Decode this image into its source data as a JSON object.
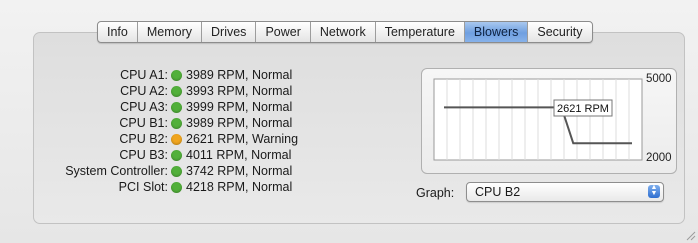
{
  "tabs": [
    {
      "label": "Info"
    },
    {
      "label": "Memory"
    },
    {
      "label": "Drives"
    },
    {
      "label": "Power"
    },
    {
      "label": "Network"
    },
    {
      "label": "Temperature"
    },
    {
      "label": "Blowers",
      "selected": true
    },
    {
      "label": "Security"
    }
  ],
  "blowers": [
    {
      "label": "CPU A1:",
      "value": "3989 RPM, Normal",
      "status": "normal"
    },
    {
      "label": "CPU A2:",
      "value": "3993 RPM, Normal",
      "status": "normal"
    },
    {
      "label": "CPU A3:",
      "value": "3999 RPM, Normal",
      "status": "normal"
    },
    {
      "label": "CPU B1:",
      "value": "3989 RPM, Normal",
      "status": "normal"
    },
    {
      "label": "CPU B2:",
      "value": "2621 RPM, Warning",
      "status": "warning"
    },
    {
      "label": "CPU B3:",
      "value": "4011 RPM, Normal",
      "status": "normal"
    },
    {
      "label": "System Controller:",
      "value": "3742 RPM, Normal",
      "status": "normal"
    },
    {
      "label": "PCI Slot:",
      "value": "4218 RPM, Normal",
      "status": "normal"
    }
  ],
  "status_colors": {
    "normal": "#52b03a",
    "warning": "#f0a51e"
  },
  "graph": {
    "axis_max": "5000",
    "axis_min": "2000",
    "current_label": "2621 RPM",
    "label": "Graph:",
    "selected": "CPU B2",
    "chart_data": {
      "type": "line",
      "series": [
        {
          "values": [
            3950,
            3950,
            3950,
            3950,
            3950,
            3950,
            3950,
            3950,
            3950,
            3950,
            3950,
            2621,
            2621,
            2621,
            2621,
            2621,
            2621
          ]
        }
      ],
      "ylim": [
        2000,
        5000
      ]
    }
  }
}
